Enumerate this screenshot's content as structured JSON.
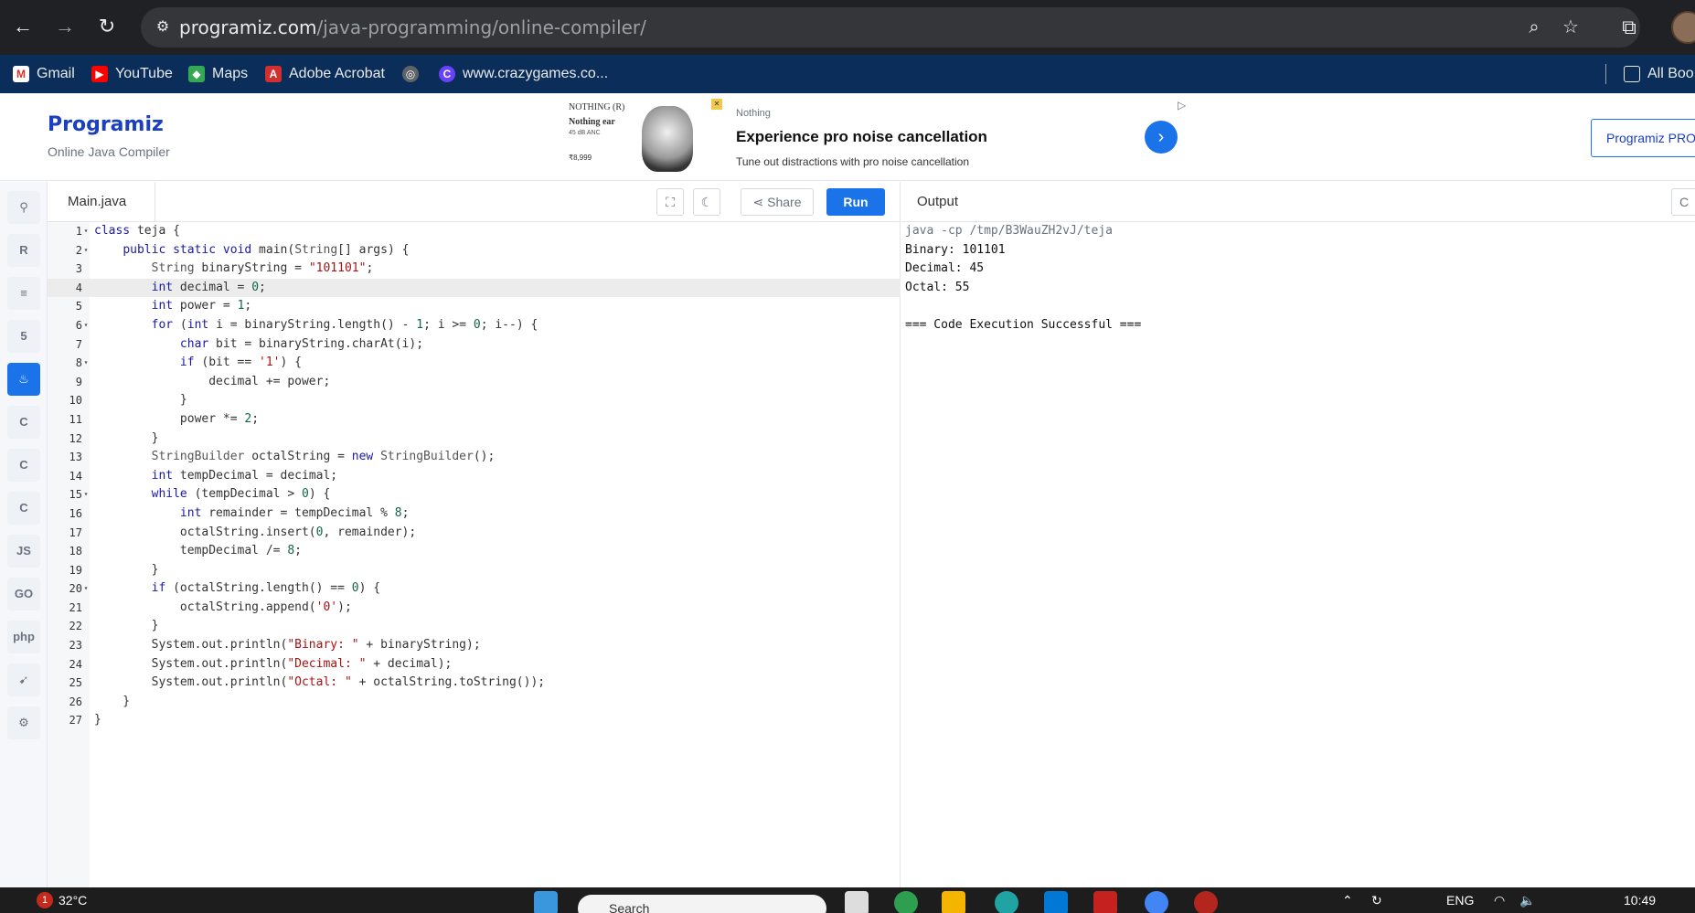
{
  "browser": {
    "url_host": "programiz.com",
    "url_path": "/java-programming/online-compiler/",
    "bookmarks": [
      "Gmail",
      "YouTube",
      "Maps",
      "Adobe Acrobat",
      "www.crazygames.co...",
      "All Boo"
    ]
  },
  "site": {
    "logo": "Programiz",
    "subtitle": "Online Java Compiler",
    "pro_label": "Programiz PRO"
  },
  "ad": {
    "brand": "NOTHING (R)",
    "product": "Nothing ear",
    "spec": "45 dB ANC",
    "price": "₹8,999",
    "sponsor": "Nothing",
    "title": "Experience pro noise cancellation",
    "description": "Tune out distractions with pro noise cancellation"
  },
  "editor": {
    "file_name": "Main.java",
    "share_label": "Share",
    "run_label": "Run",
    "active_line": 4,
    "lines": [
      "class teja {",
      "    public static void main(String[] args) {",
      "        String binaryString = \"101101\";",
      "        int decimal = 0;",
      "        int power = 1;",
      "        for (int i = binaryString.length() - 1; i >= 0; i--) {",
      "            char bit = binaryString.charAt(i);",
      "            if (bit == '1') {",
      "                decimal += power;",
      "            }",
      "            power *= 2;",
      "        }",
      "        StringBuilder octalString = new StringBuilder();",
      "        int tempDecimal = decimal;",
      "        while (tempDecimal > 0) {",
      "            int remainder = tempDecimal % 8;",
      "            octalString.insert(0, remainder);",
      "            tempDecimal /= 8;",
      "        }",
      "        if (octalString.length() == 0) {",
      "            octalString.append('0');",
      "        }",
      "        System.out.println(\"Binary: \" + binaryString);",
      "        System.out.println(\"Decimal: \" + decimal);",
      "        System.out.println(\"Octal: \" + octalString.toString());",
      "    }",
      "}"
    ],
    "foldable": [
      1,
      2,
      6,
      8,
      15,
      20
    ]
  },
  "output": {
    "title": "Output",
    "clear_label": "C",
    "lines": [
      "java -cp /tmp/B3WauZH2vJ/teja",
      "Binary: 101101",
      "Decimal: 45",
      "Octal: 55",
      "",
      "=== Code Execution Successful ==="
    ]
  },
  "rail": {
    "languages": [
      "python-icon",
      "r-icon",
      "sql-icon",
      "html-icon",
      "java-icon",
      "c-icon",
      "cpp-icon",
      "csharp-icon",
      "js-icon",
      "go-icon",
      "php-icon",
      "swift-icon",
      "rust-icon"
    ],
    "labels": [
      "",
      "",
      "",
      "",
      "",
      "",
      "",
      "",
      "JS",
      "GO",
      "php",
      "",
      ""
    ],
    "active": 4
  },
  "taskbar": {
    "temperature": "32°C",
    "notification_count": "1",
    "search_placeholder": "Search",
    "language": "ENG",
    "time": "10:49"
  },
  "colors": {
    "accent": "#1a73e8",
    "keyword": "#1a1aa6",
    "string": "#a11",
    "number": "#164"
  }
}
